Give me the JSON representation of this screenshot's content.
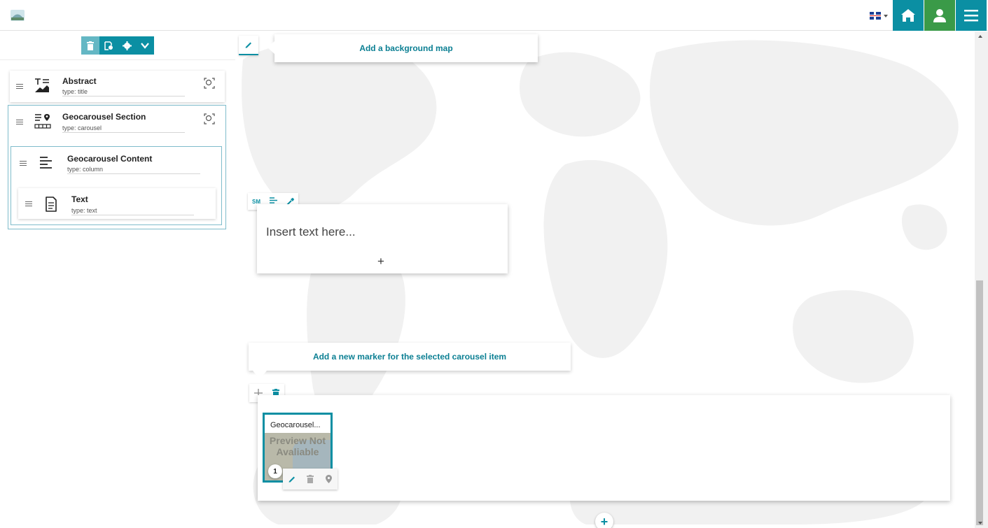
{
  "header": {
    "logo_icon": "app-logo",
    "language_icon": "uk-flag-icon",
    "home_icon": "home-icon",
    "user_icon": "user-icon",
    "menu_icon": "hamburger-menu-icon",
    "colors": {
      "accent": "#0b8fa3",
      "user": "#3a9a48"
    }
  },
  "tree": {
    "toolbar_icons": [
      "trash-icon",
      "preview-icon",
      "gear-icon",
      "chevron-down-icon"
    ],
    "nodes": [
      {
        "title": "Abstract",
        "type": "type: title",
        "icon": "title-icon"
      },
      {
        "title": "Geocarousel Section",
        "type": "type: carousel",
        "icon": "carousel-icon"
      },
      {
        "title": "Geocarousel Content",
        "type": "type: column",
        "icon": "column-icon"
      },
      {
        "title": "Text",
        "type": "type: text",
        "icon": "text-doc-icon"
      }
    ]
  },
  "map": {
    "background_tip": "Add a background map",
    "text_tools": {
      "size_label": "SM"
    },
    "text_placeholder": "Insert text here...",
    "add_symbol": "+",
    "marker_tip": "Add a new marker for the selected carousel item",
    "add_marker_symbol": "+",
    "carousel_item": {
      "title": "Geocarousel...",
      "preview_text": "Preview Not Avaliable",
      "number": "1"
    },
    "add_section_symbol": "+"
  }
}
